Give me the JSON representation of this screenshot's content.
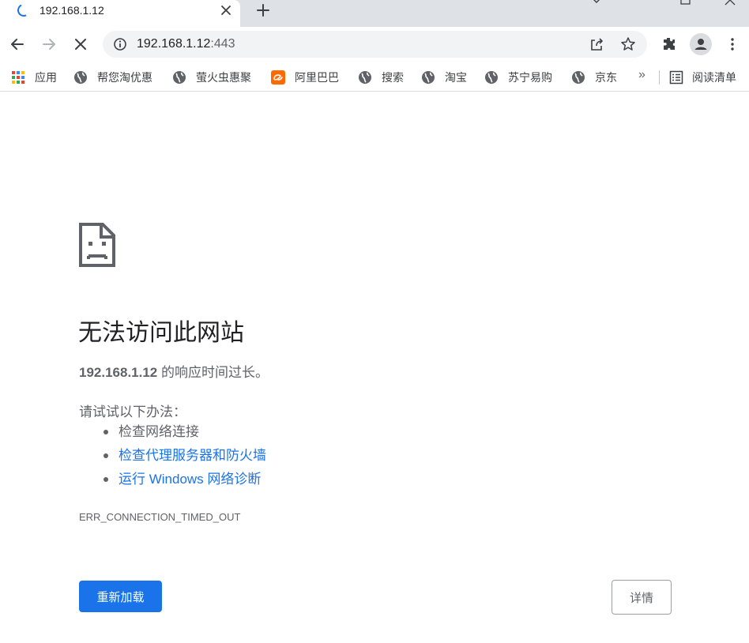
{
  "tab": {
    "title": "192.168.1.12",
    "loading": true
  },
  "toolbar": {
    "url_host": "192.168.1.12",
    "url_port": ":443",
    "icons": [
      "back-arrow-icon",
      "forward-arrow-icon",
      "stop-loading-icon",
      "site-info-icon",
      "share-icon",
      "star-icon",
      "extensions-icon",
      "profile-icon",
      "menu-icon"
    ]
  },
  "bookmarks": {
    "items": [
      {
        "label": "应用",
        "icon": "apps-grid-icon"
      },
      {
        "label": "帮您淘优惠",
        "icon": "globe-icon"
      },
      {
        "label": "萤火虫惠聚",
        "icon": "globe-icon"
      },
      {
        "label": "阿里巴巴",
        "icon": "alibaba-logo-icon"
      },
      {
        "label": "搜索",
        "icon": "globe-icon"
      },
      {
        "label": "淘宝",
        "icon": "globe-icon"
      },
      {
        "label": "苏宁易购",
        "icon": "globe-icon"
      },
      {
        "label": "京东",
        "icon": "globe-icon"
      }
    ],
    "more": "»",
    "reading_list": "阅读清单"
  },
  "error": {
    "title": "无法访问此网站",
    "host": "192.168.1.12",
    "summary_suffix": " 的响应时间过长。",
    "try_label": "请试试以下办法：",
    "suggestions": [
      {
        "text": "检查网络连接",
        "link": false
      },
      {
        "text": "检查代理服务器和防火墙",
        "link": true
      },
      {
        "text": "运行 Windows 网络诊断",
        "link": true
      }
    ],
    "code": "ERR_CONNECTION_TIMED_OUT",
    "reload_button": "重新加载",
    "details_button": "详情"
  },
  "colors": {
    "accent": "#1a73e8",
    "tabstrip": "#dee1e6",
    "omnibox": "#f1f3f4",
    "secondary_text": "#5f6368"
  }
}
